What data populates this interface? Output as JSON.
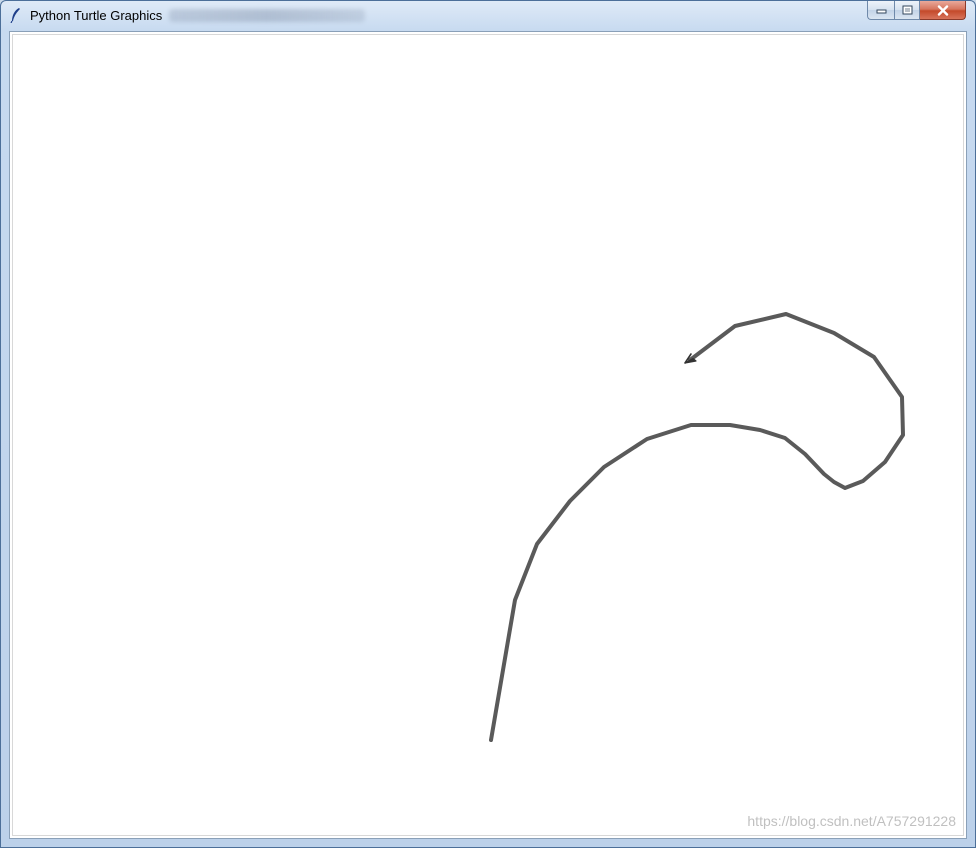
{
  "window": {
    "title": "Python Turtle Graphics",
    "controls": {
      "minimize_icon": "minimize-icon",
      "maximize_icon": "maximize-icon",
      "close_icon": "close-icon"
    }
  },
  "canvas": {
    "background": "#ffffff",
    "pen_color": "#555555",
    "turtle_shape": "classic-arrow"
  },
  "watermark": {
    "text": "https://blog.csdn.net/A757291228"
  }
}
